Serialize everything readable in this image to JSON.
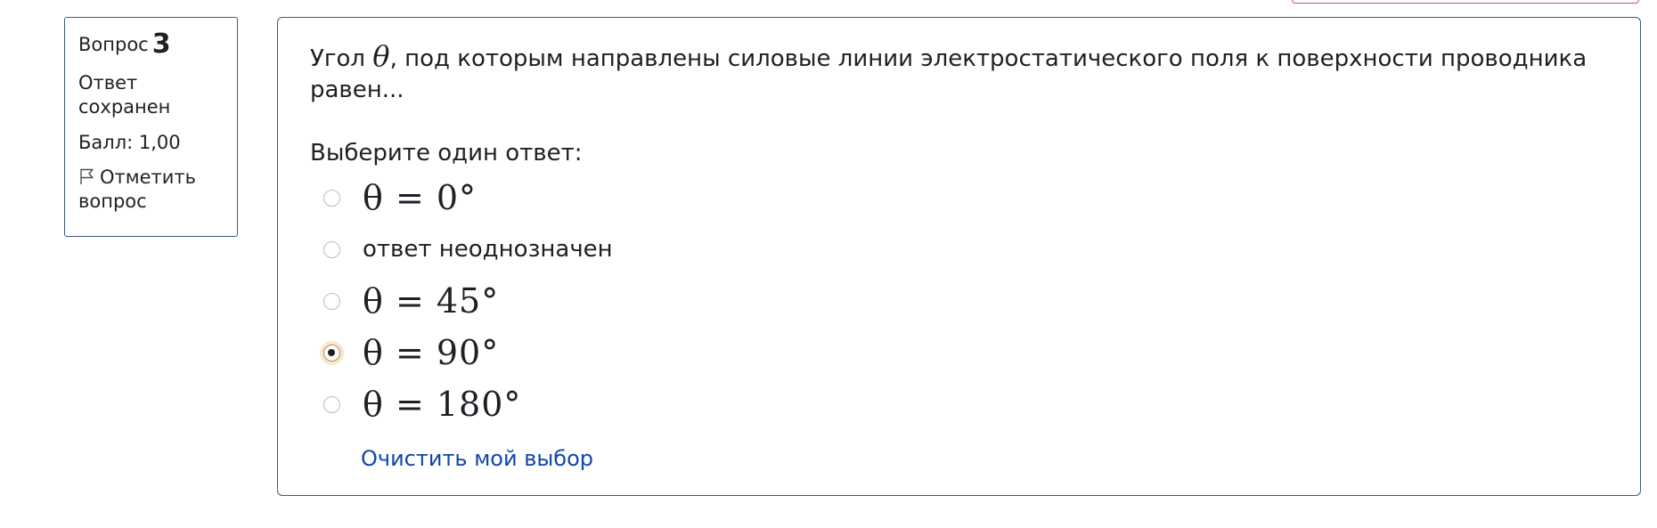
{
  "info": {
    "question_label": "Вопрос",
    "question_number": "3",
    "status": "Ответ сохранен",
    "score": "Балл: 1,00",
    "flag_label": "Отметить вопрос"
  },
  "question": {
    "text_before": "Угол ",
    "theta": "θ",
    "text_after": ", под которым направлены силовые линии электростатического поля к поверхности проводника равен...",
    "prompt": "Выберите один ответ:"
  },
  "answers": [
    {
      "label": "θ = 0°",
      "is_math": true,
      "selected": false
    },
    {
      "label": "ответ неоднозначен",
      "is_math": false,
      "selected": false
    },
    {
      "label": "θ = 45°",
      "is_math": true,
      "selected": false
    },
    {
      "label": "θ = 90°",
      "is_math": true,
      "selected": true
    },
    {
      "label": "θ = 180°",
      "is_math": true,
      "selected": false
    }
  ],
  "clear_label": "Очистить мой выбор",
  "colors": {
    "border": "#3e5a7d",
    "link": "#0f47ad",
    "selected_ring": "#f6e7cf"
  },
  "icons": {
    "flag": "flag-icon"
  }
}
